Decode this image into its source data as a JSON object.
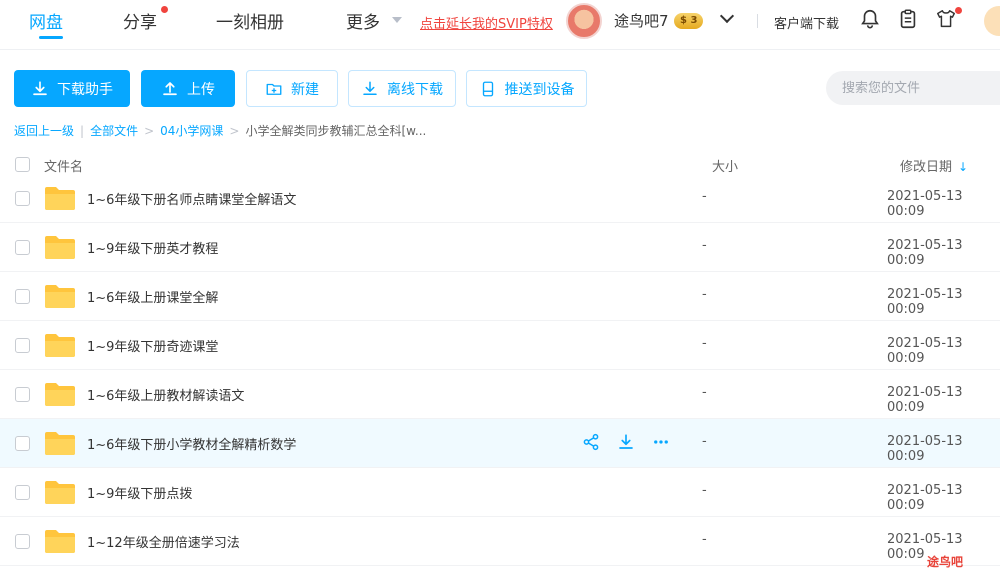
{
  "nav": {
    "tabs": [
      "网盘",
      "分享",
      "一刻相册",
      "更多"
    ],
    "svip_link": "点击延长我的SVIP特权",
    "username": "途鸟吧7",
    "coin_badge": "$ 3",
    "client_download": "客户端下载"
  },
  "toolbar": {
    "download": "下载助手",
    "upload": "上传",
    "new": "新建",
    "offline": "离线下载",
    "push": "推送到设备",
    "search_placeholder": "搜索您的文件"
  },
  "breadcrumb": {
    "back": "返回上一级",
    "all": "全部文件",
    "folder": "04小学网课",
    "current": "小学全解类同步教辅汇总全科[w..."
  },
  "table": {
    "col_name": "文件名",
    "col_size": "大小",
    "col_date": "修改日期"
  },
  "files": [
    {
      "name": "1~6年级下册名师点睛课堂全解语文",
      "size": "-",
      "date": "2021-05-13 00:09"
    },
    {
      "name": "1~9年级下册英才教程",
      "size": "-",
      "date": "2021-05-13 00:09"
    },
    {
      "name": "1~6年级上册课堂全解",
      "size": "-",
      "date": "2021-05-13 00:09"
    },
    {
      "name": "1~9年级下册奇迹课堂",
      "size": "-",
      "date": "2021-05-13 00:09"
    },
    {
      "name": "1~6年级上册教材解读语文",
      "size": "-",
      "date": "2021-05-13 00:09"
    },
    {
      "name": "1~6年级下册小学教材全解精析数学",
      "size": "-",
      "date": "2021-05-13 00:09"
    },
    {
      "name": "1~9年级下册点拨",
      "size": "-",
      "date": "2021-05-13 00:09"
    },
    {
      "name": "1~12年级全册倍速学习法",
      "size": "-",
      "date": "2021-05-13 00:09"
    }
  ],
  "watermark": "途鸟吧",
  "colors": {
    "accent": "#06a7ff",
    "folder": "#ffc53d",
    "alert": "#f0443e"
  }
}
